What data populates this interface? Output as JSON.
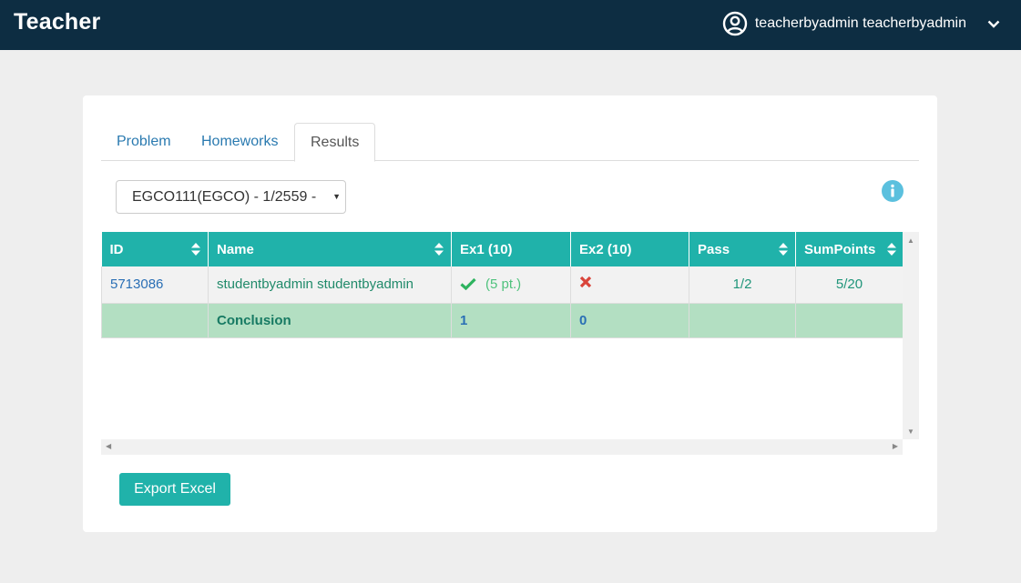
{
  "navbar": {
    "brand": "Teacher",
    "user_name": "teacherbyadmin teacherbyadmin",
    "user_icon": "user-circle-icon",
    "menu_icon": "chevron-down-icon"
  },
  "tabs": [
    {
      "label": "Problem",
      "active": false
    },
    {
      "label": "Homeworks",
      "active": false
    },
    {
      "label": "Results",
      "active": true
    }
  ],
  "course_select": {
    "selected": "EGCO111(EGCO) - 1/2559 -"
  },
  "info_icon": "info-circle-icon",
  "table": {
    "columns": [
      "ID",
      "Name",
      "Ex1 (10)",
      "Ex2 (10)",
      "Pass",
      "SumPoints"
    ],
    "rows": [
      {
        "id": "5713086",
        "name": "studentbyadmin studentbyadmin",
        "ex1_points": "(5 pt.)",
        "ex1_status": "check-icon",
        "ex2_status": "x-icon",
        "pass": "1/2",
        "sum_points": "5/20"
      }
    ],
    "conclusion": {
      "label": "Conclusion",
      "ex1": "1",
      "ex2": "0"
    }
  },
  "export_button": "Export Excel",
  "colors": {
    "navbar": "#0d2d42",
    "accent": "#20b2aa",
    "conclusion_row": "#b3dfc2",
    "link": "#2a7ab0"
  }
}
